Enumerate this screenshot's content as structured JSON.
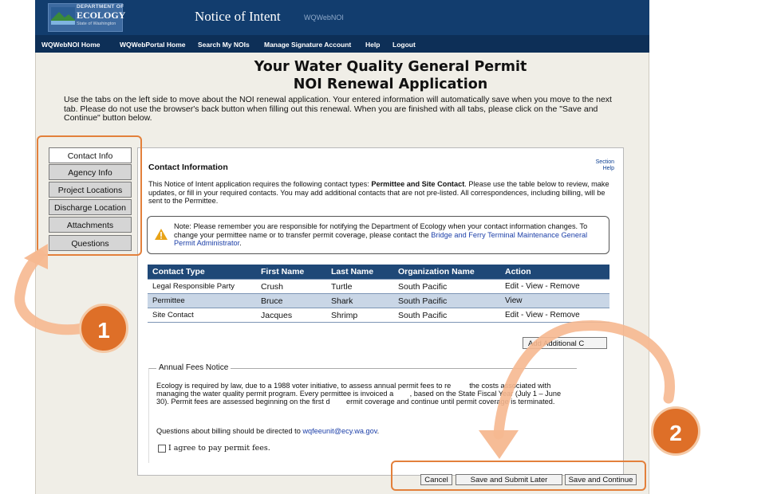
{
  "header": {
    "logo_dept": "DEPARTMENT OF",
    "logo_name": "ECOLOGY",
    "logo_state": "State of Washington",
    "app_title": "Notice of Intent",
    "app_subtitle": "WQWebNOI"
  },
  "nav": [
    "WQWebNOI Home",
    "WQWebPortal Home",
    "Search My NOIs",
    "Manage Signature Account",
    "Help",
    "Logout"
  ],
  "page": {
    "title_line1": "Your Water Quality General Permit",
    "title_line2": "NOI Renewal Application",
    "intro": "Use the tabs on the left side to move about the NOI renewal application. Your entered information will automatically save when you move to the next tab. Please do not use the browser's back button when filling out this renewal. When you are finished with all tabs, please click on the \"Save and Continue\" button below."
  },
  "tabs": [
    "Contact Info",
    "Agency Info",
    "Project Locations",
    "Discharge Location",
    "Attachments",
    "Questions"
  ],
  "active_tab": "Contact Info",
  "section": {
    "title": "Contact Information",
    "help_line1": "Section",
    "help_line2": "Help",
    "desc_pre": "This Notice of Intent application requires the following contact types: ",
    "desc_bold": "Permittee and Site Contact",
    "desc_post": ". Please use the table below to review, make updates, or fill in your required contacts. You may add additional contacts that are not pre-listed. All correspondences, including billing, will be sent to the Permittee."
  },
  "note": {
    "text": "Note: Please remember you are responsible for notifying the Department of Ecology when your contact information changes. To change your permittee name or to transfer permit coverage, please contact the ",
    "link": "Bridge and Ferry Terminal Maintenance General Permit Administrator",
    "end": "."
  },
  "table": {
    "headers": [
      "Contact Type",
      "First Name",
      "Last Name",
      "Organization Name",
      "Action"
    ],
    "rows": [
      {
        "type": "Legal Responsible Party",
        "first": "Crush",
        "last": "Turtle",
        "org": "South Pacific",
        "action": "Edit - View - Remove"
      },
      {
        "type": "Permittee",
        "first": "Bruce",
        "last": "Shark",
        "org": "South Pacific",
        "action": "View"
      },
      {
        "type": "Site Contact",
        "first": "Jacques",
        "last": "Shrimp",
        "org": "South Pacific",
        "action": "Edit - View - Remove"
      }
    ],
    "add_button": "Add Additional C"
  },
  "fees": {
    "legend": "Annual Fees Notice",
    "text": "Ecology is required by law, due to a 1988 voter initiative, to assess annual permit fees to re         the costs associated with managing the water quality permit program. Every permittee is invoiced a        , based on the State Fiscal Year (July 1 – June 30). Permit fees are assessed beginning on the first d        ermit coverage and continue until permit coverage is terminated.",
    "question_pre": "Questions about billing should be directed to ",
    "question_link": "wqfeeunit@ecy.wa.gov",
    "question_end": ".",
    "agree_label": "I agree to pay permit fees."
  },
  "buttons": {
    "cancel": "Cancel",
    "save_later": "Save and Submit Later",
    "save_continue": "Save and Continue"
  },
  "callouts": {
    "one": "1",
    "two": "2",
    "accent_color": "#de6f28"
  }
}
